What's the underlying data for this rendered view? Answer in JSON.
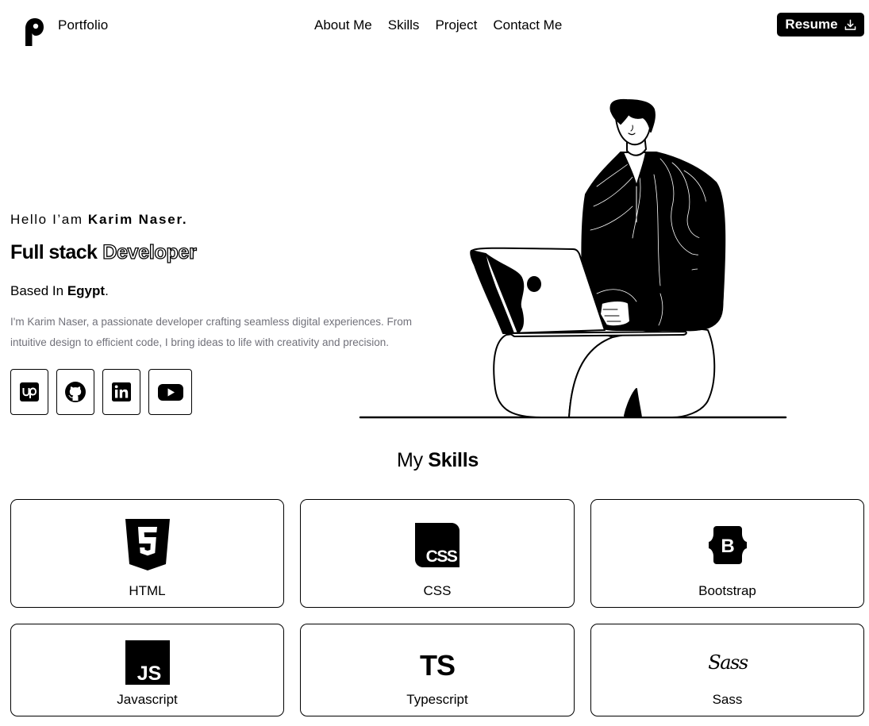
{
  "header": {
    "brand": "Portfolio",
    "nav": [
      "About Me",
      "Skills",
      "Project",
      "Contact Me"
    ],
    "resume_label": "Resume"
  },
  "hero": {
    "greeting": "Hello I’am ",
    "name": "Karim Naser.",
    "role_plain": "Full stack",
    "role_outline": "Developer",
    "based_prefix": "Based In ",
    "location": "Egypt",
    "based_suffix": ".",
    "bio": "I'm Karim Naser, a passionate developer crafting seamless digital experiences. From intuitive design to efficient code, I bring ideas to life with creativity and precision."
  },
  "socials": [
    {
      "name": "upwork",
      "icon": "upwork-icon"
    },
    {
      "name": "github",
      "icon": "github-icon"
    },
    {
      "name": "linkedin",
      "icon": "linkedin-icon"
    },
    {
      "name": "youtube",
      "icon": "youtube-icon"
    }
  ],
  "skills": {
    "title_plain": "My ",
    "title_bold": "Skills",
    "items": [
      {
        "label": "HTML",
        "icon": "html5-icon"
      },
      {
        "label": "CSS",
        "icon": "css3-icon"
      },
      {
        "label": "Bootstrap",
        "icon": "bootstrap-icon"
      },
      {
        "label": "Javascript",
        "icon": "javascript-icon"
      },
      {
        "label": "Typescript",
        "icon": "typescript-icon"
      },
      {
        "label": "Sass",
        "icon": "sass-icon"
      }
    ]
  }
}
